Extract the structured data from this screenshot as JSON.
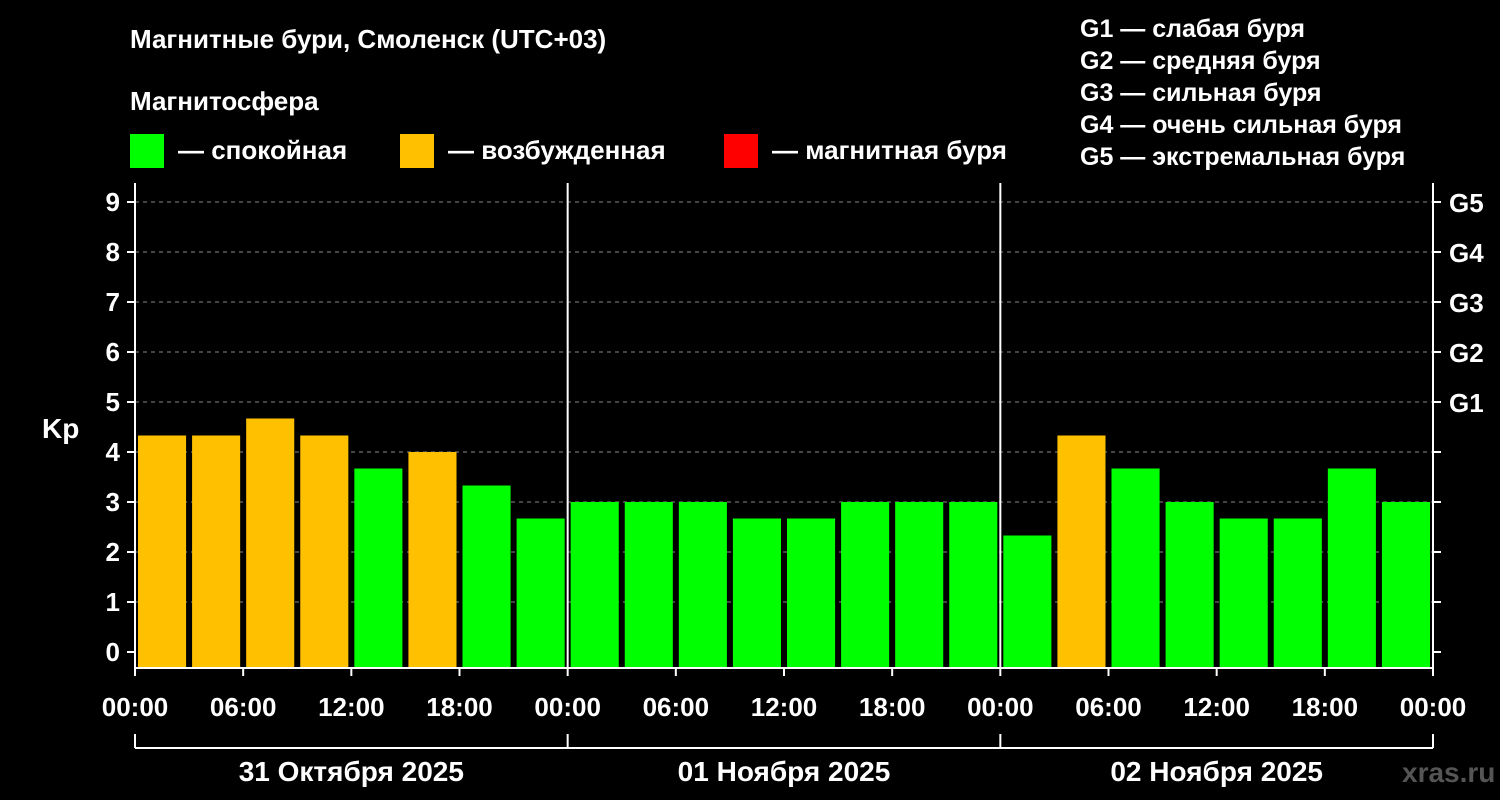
{
  "title": "Магнитные бури, Смоленск (UTC+03)",
  "magnetosphere_label": "Магнитосфера",
  "legend": [
    {
      "color": "#00ff00",
      "label": "— спокойная"
    },
    {
      "color": "#ffc000",
      "label": "— возбужденная"
    },
    {
      "color": "#ff0000",
      "label": "— магнитная буря"
    }
  ],
  "g_levels": [
    "G1 — слабая буря",
    "G2 — средняя буря",
    "G3 — сильная буря",
    "G4 — очень сильная буря",
    "G5 — экстремальная буря"
  ],
  "watermark": "xras.ru",
  "chart_data": {
    "type": "bar",
    "ylabel": "Kp",
    "ylim": [
      0,
      9
    ],
    "y_ticks": [
      "0",
      "1",
      "2",
      "3",
      "4",
      "5",
      "6",
      "7",
      "8",
      "9"
    ],
    "right_ticks": [
      {
        "kp": 5,
        "label": "G1"
      },
      {
        "kp": 6,
        "label": "G2"
      },
      {
        "kp": 7,
        "label": "G3"
      },
      {
        "kp": 8,
        "label": "G4"
      },
      {
        "kp": 9,
        "label": "G5"
      }
    ],
    "x_ticks": [
      "00:00",
      "06:00",
      "12:00",
      "18:00",
      "00:00",
      "06:00",
      "12:00",
      "18:00",
      "00:00",
      "06:00",
      "12:00",
      "18:00",
      "00:00"
    ],
    "days": [
      "31 Октября 2025",
      "01 Ноября 2025",
      "02 Ноября 2025"
    ],
    "grid": "dashed horizontal",
    "values": [
      4.33,
      4.33,
      4.67,
      4.33,
      3.67,
      4.0,
      3.33,
      2.67,
      3.0,
      3.0,
      3.0,
      2.67,
      2.67,
      3.0,
      3.0,
      3.0,
      2.33,
      4.33,
      3.67,
      3.0,
      2.67,
      2.67,
      3.67,
      3.0
    ],
    "colors": [
      "#ffc000",
      "#ffc000",
      "#ffc000",
      "#ffc000",
      "#00ff00",
      "#ffc000",
      "#00ff00",
      "#00ff00",
      "#00ff00",
      "#00ff00",
      "#00ff00",
      "#00ff00",
      "#00ff00",
      "#00ff00",
      "#00ff00",
      "#00ff00",
      "#00ff00",
      "#ffc000",
      "#00ff00",
      "#00ff00",
      "#00ff00",
      "#00ff00",
      "#00ff00",
      "#00ff00"
    ]
  }
}
